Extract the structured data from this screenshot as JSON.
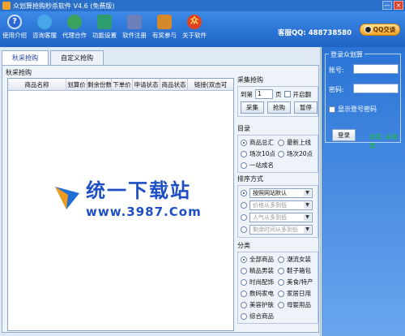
{
  "window": {
    "title": "众划算抢购秒杀软件 V4.6 (免费版)",
    "minimize_label": "—",
    "close_label": "×"
  },
  "toolbar": {
    "items": [
      {
        "label": "使用介绍",
        "icon": "help-icon",
        "color": "#2b67d6"
      },
      {
        "label": "咨询客服",
        "icon": "customer-service-icon",
        "color": "#47a6e8"
      },
      {
        "label": "代理合作",
        "icon": "partner-icon",
        "color": "#3aa35b"
      },
      {
        "label": "功能设置",
        "icon": "settings-icon",
        "color": "#2d9c6e"
      },
      {
        "label": "软件注册",
        "icon": "register-icon",
        "color": "#6b7fb8"
      },
      {
        "label": "有奖参与",
        "icon": "gift-icon",
        "color": "#d48a2a"
      },
      {
        "label": "关于软件",
        "icon": "about-icon",
        "color": "#e0441f"
      }
    ],
    "qq_label": "客服QQ: 488738580",
    "qq_button": "QQ交谈"
  },
  "tabs": [
    {
      "label": "秋采抢购",
      "active": true
    },
    {
      "label": "自定义抢购",
      "active": false
    }
  ],
  "panel": {
    "section_label": "秋采抢购",
    "columns": [
      "商品名称",
      "划算价",
      "剩余份数",
      "下单价",
      "申请状态",
      "商品状态",
      "链接(双击可"
    ],
    "watermark_text": "统一下载站",
    "watermark_sub": "www.3987.Com"
  },
  "collect": {
    "title": "采集抢购",
    "page_prefix": "到第",
    "page_value": "1",
    "page_suffix": "页",
    "auto_scroll_label": "开启翻",
    "buttons": [
      "采集",
      "抢购",
      "暂停"
    ]
  },
  "catalog": {
    "title": "目录",
    "options": [
      {
        "label": "商品总汇",
        "selected": true
      },
      {
        "label": "最新上线",
        "selected": false
      },
      {
        "label": "场次10点",
        "selected": false
      },
      {
        "label": "场次20点",
        "selected": false
      },
      {
        "label": "一站成名",
        "selected": false
      }
    ]
  },
  "sort": {
    "title": "排序方式",
    "options": [
      {
        "label": "按照网站默认",
        "selected": true
      },
      {
        "label": "价格从多到低",
        "selected": false
      },
      {
        "label": "人气从多到低",
        "selected": false
      },
      {
        "label": "剩余时间从多到低",
        "selected": false
      }
    ]
  },
  "category": {
    "title": "分类",
    "options": [
      {
        "label": "全部商品",
        "selected": true
      },
      {
        "label": "潮流女装",
        "selected": false
      },
      {
        "label": "精品男装",
        "selected": false
      },
      {
        "label": "鞋子箱包",
        "selected": false
      },
      {
        "label": "时尚配饰",
        "selected": false
      },
      {
        "label": "美食/特产",
        "selected": false
      },
      {
        "label": "数码家电",
        "selected": false
      },
      {
        "label": "家居日用",
        "selected": false
      },
      {
        "label": "美容护肤",
        "selected": false
      },
      {
        "label": "母婴用品",
        "selected": false
      },
      {
        "label": "综合商品",
        "selected": false
      }
    ]
  },
  "login": {
    "title": "登录众划算",
    "account_label": "账号:",
    "account_value": "",
    "password_label": "密码:",
    "password_value": "",
    "show_password_label": "显示登号密码",
    "login_button": "登录",
    "status_label": "状态: 未登录"
  }
}
